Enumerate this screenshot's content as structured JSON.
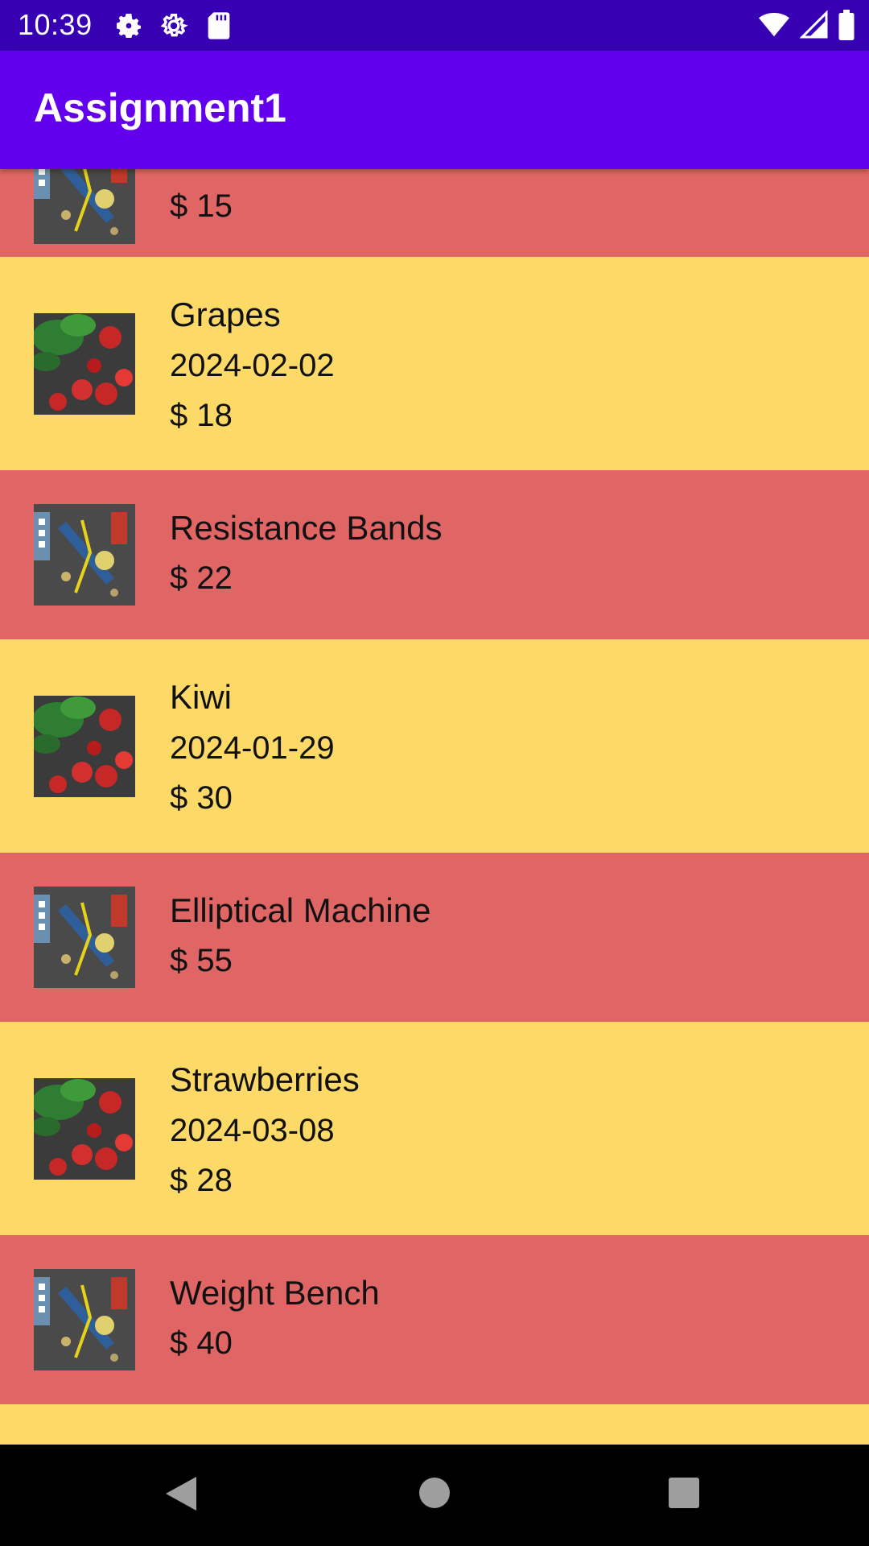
{
  "status_bar": {
    "time": "10:39"
  },
  "app_bar": {
    "title": "Assignment1"
  },
  "items": [
    {
      "name": "",
      "date": "",
      "price": "$ 15",
      "image": "tools-image"
    },
    {
      "name": "Grapes",
      "date": "2024-02-02",
      "price": "$ 18",
      "image": "vegetables-image"
    },
    {
      "name": "Resistance Bands",
      "date": "",
      "price": "$ 22",
      "image": "tools-image"
    },
    {
      "name": "Kiwi",
      "date": "2024-01-29",
      "price": "$ 30",
      "image": "vegetables-image"
    },
    {
      "name": "Elliptical Machine",
      "date": "",
      "price": "$ 55",
      "image": "tools-image"
    },
    {
      "name": "Strawberries",
      "date": "2024-03-08",
      "price": "$ 28",
      "image": "vegetables-image"
    },
    {
      "name": "Weight Bench",
      "date": "",
      "price": "$ 40",
      "image": "tools-image"
    }
  ],
  "colors": {
    "status_bar": "#3700B3",
    "app_bar": "#6200EE",
    "row_red": "#E06666",
    "row_yellow": "#FDD968"
  }
}
